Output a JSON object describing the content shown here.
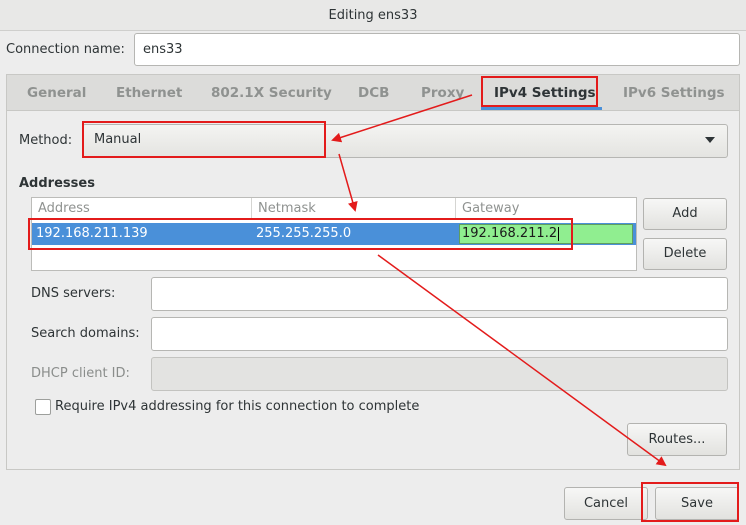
{
  "window": {
    "title": "Editing ens33"
  },
  "connection": {
    "name_label": "Connection name:",
    "name_value": "ens33"
  },
  "tabs": [
    {
      "label": "General"
    },
    {
      "label": "Ethernet"
    },
    {
      "label": "802.1X Security"
    },
    {
      "label": "DCB"
    },
    {
      "label": "Proxy"
    },
    {
      "label": "IPv4 Settings",
      "active": true
    },
    {
      "label": "IPv6 Settings"
    }
  ],
  "ipv4": {
    "method_label": "Method:",
    "method_value": "Manual",
    "addresses_label": "Addresses",
    "columns": [
      "Address",
      "Netmask",
      "Gateway"
    ],
    "rows": [
      {
        "address": "192.168.211.139",
        "netmask": "255.255.255.0",
        "gateway": "192.168.211.2"
      }
    ],
    "add_label": "Add",
    "delete_label": "Delete",
    "dns_label": "DNS servers:",
    "dns_value": "",
    "search_label": "Search domains:",
    "search_value": "",
    "dhcp_label": "DHCP client ID:",
    "dhcp_value": "",
    "require_label": "Require IPv4 addressing for this connection to complete",
    "require_checked": false,
    "routes_label": "Routes..."
  },
  "footer": {
    "cancel_label": "Cancel",
    "save_label": "Save"
  },
  "colors": {
    "selection": "#4a90d9",
    "edit_highlight": "#90ee90",
    "annotation": "#e31b1b"
  }
}
